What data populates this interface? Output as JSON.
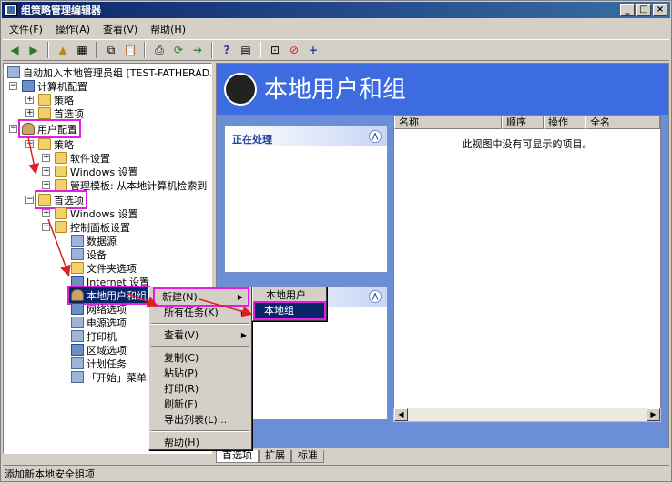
{
  "window": {
    "title": "组策略管理编辑器"
  },
  "menubar": [
    "文件(F)",
    "操作(A)",
    "查看(V)",
    "帮助(H)"
  ],
  "tree": {
    "root": "自动加入本地管理员组 [TEST-FATHERAD.Z",
    "computer_config": "计算机配置",
    "cc_policies": "策略",
    "cc_prefs": "首选项",
    "user_config": "用户配置",
    "uc_policies": "策略",
    "software_settings": "软件设置",
    "windows_settings": "Windows 设置",
    "admin_templates": "管理模板: 从本地计算机检索到",
    "uc_prefs": "首选项",
    "prefs_windows_settings": "Windows 设置",
    "control_panel_settings": "控制面板设置",
    "data_sources": "数据源",
    "devices": "设备",
    "folder_options": "文件夹选项",
    "internet_settings": "Internet 设置",
    "local_users_groups": "本地用户和组",
    "network_options": "网络选项",
    "power_options": "电源选项",
    "printers": "打印机",
    "regional_options": "区域选项",
    "scheduled_tasks": "计划任务",
    "start_menu": "「开始」菜单"
  },
  "header": {
    "title": "本地用户和组"
  },
  "tasks": {
    "title": "正在处理"
  },
  "list": {
    "columns": [
      "名称",
      "顺序",
      "操作",
      "全名"
    ],
    "empty_text": "此视图中没有可显示的项目。"
  },
  "context_menu": {
    "new": "新建(N)",
    "all_tasks": "所有任务(K)",
    "view": "查看(V)",
    "copy": "复制(C)",
    "paste": "粘贴(P)",
    "print": "打印(R)",
    "refresh": "刷新(F)",
    "export": "导出列表(L)...",
    "help": "帮助(H)"
  },
  "submenu": {
    "local_user": "本地用户",
    "local_group": "本地组"
  },
  "tabs": [
    "首选项",
    "扩展",
    "标准"
  ],
  "status": "添加新本地安全组项",
  "colors": {
    "title_bar": "#0a246a",
    "highlight": "#e020e0",
    "arrow": "#e02020",
    "header": "#3d6be0",
    "task_pane": "#6b8fd7"
  }
}
